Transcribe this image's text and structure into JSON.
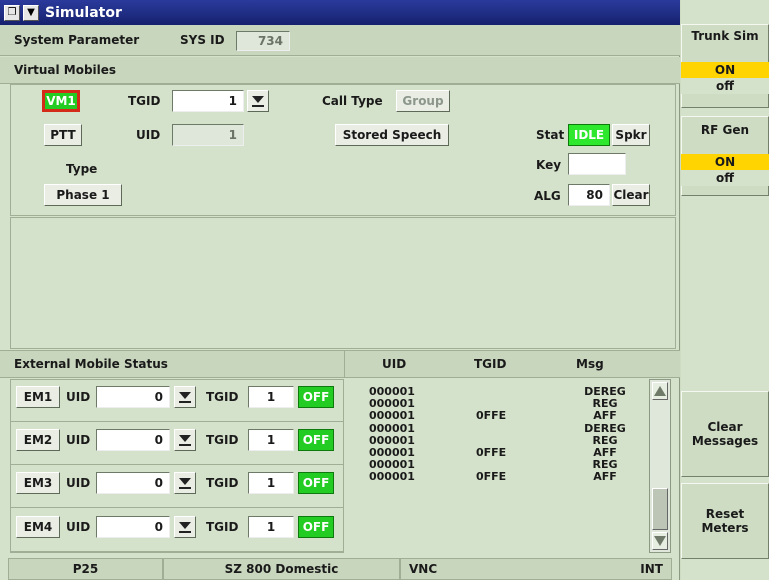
{
  "window": {
    "title": "Simulator"
  },
  "system_parameter": {
    "label": "System Parameter",
    "sys_id_label": "SYS ID",
    "sys_id_value": "734"
  },
  "virtual_mobiles": {
    "header": "Virtual Mobiles",
    "vm_button": "VM1",
    "tgid_label": "TGID",
    "tgid_value": "1",
    "call_type_label": "Call Type",
    "call_type_value": "Group",
    "ptt_button": "PTT",
    "uid_label": "UID",
    "uid_value": "1",
    "stored_speech_button": "Stored Speech",
    "stat_label": "Stat",
    "stat_value": "IDLE",
    "spkr_button": "Spkr",
    "type_label": "Type",
    "type_button": "Phase 1",
    "key_label": "Key",
    "key_value": "",
    "alg_label": "ALG",
    "alg_value": "80",
    "clear_button": "Clear"
  },
  "external_mobile_status": {
    "header": "External Mobile Status",
    "mobiles": [
      {
        "name": "EM1",
        "uid_label": "UID",
        "uid_value": "0",
        "tgid_label": "TGID",
        "tgid_value": "1",
        "state": "OFF"
      },
      {
        "name": "EM2",
        "uid_label": "UID",
        "uid_value": "0",
        "tgid_label": "TGID",
        "tgid_value": "1",
        "state": "OFF"
      },
      {
        "name": "EM3",
        "uid_label": "UID",
        "uid_value": "0",
        "tgid_label": "TGID",
        "tgid_value": "1",
        "state": "OFF"
      },
      {
        "name": "EM4",
        "uid_label": "UID",
        "uid_value": "0",
        "tgid_label": "TGID",
        "tgid_value": "1",
        "state": "OFF"
      }
    ]
  },
  "messages": {
    "columns": [
      "UID",
      "TGID",
      "Msg"
    ],
    "rows": [
      {
        "uid": "000001",
        "tgid": "",
        "msg": "DEREG"
      },
      {
        "uid": "000001",
        "tgid": "",
        "msg": "REG"
      },
      {
        "uid": "000001",
        "tgid": "0FFE",
        "msg": "AFF"
      },
      {
        "uid": "000001",
        "tgid": "",
        "msg": "DEREG"
      },
      {
        "uid": "000001",
        "tgid": "",
        "msg": "REG"
      },
      {
        "uid": "000001",
        "tgid": "0FFE",
        "msg": "AFF"
      },
      {
        "uid": "000001",
        "tgid": "",
        "msg": "REG"
      },
      {
        "uid": "000001",
        "tgid": "0FFE",
        "msg": "AFF"
      }
    ]
  },
  "status_bar": {
    "mode": "P25",
    "system": "SZ 800 Domestic",
    "vnc": "VNC",
    "ref": "INT"
  },
  "sidebar": {
    "trunk_sim": {
      "label": "Trunk Sim",
      "on": "ON",
      "off": "off"
    },
    "rf_gen": {
      "label": "RF Gen",
      "on": "ON",
      "off": "off"
    },
    "clear_messages": "Clear Messages",
    "reset_meters": "Reset Meters"
  },
  "colors": {
    "title_bar": "#16226e",
    "on_highlight": "#ffd400",
    "off_green": "#22cc22",
    "idle_green": "#2ee82e",
    "vm_border": "#d42a1a"
  }
}
